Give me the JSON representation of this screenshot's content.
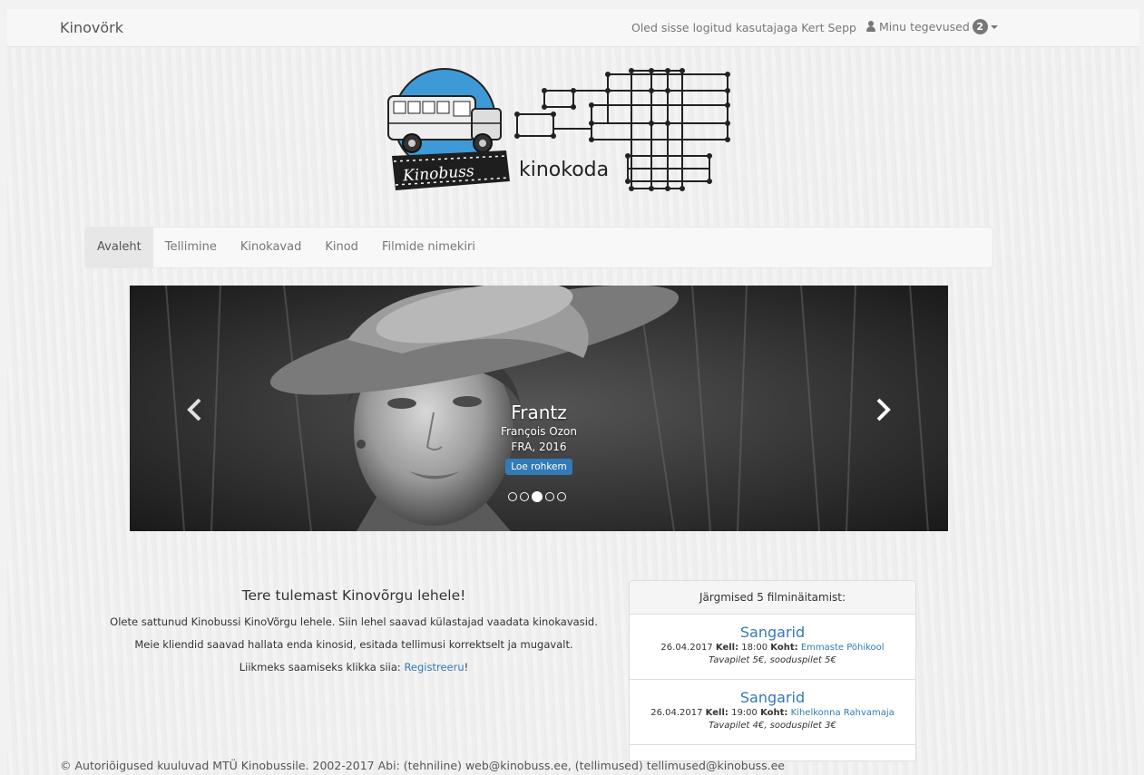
{
  "navbar": {
    "brand": "Kinovörk",
    "login_text": "Oled sisse logitud kasutajaga Kert Sepp",
    "my_actions_label": "Minu tegevused",
    "my_actions_badge": "2"
  },
  "logo": {
    "left_text": "Kinobuss",
    "right_text": "kinokoda"
  },
  "menu": {
    "items": [
      "Avaleht",
      "Tellimine",
      "Kinokavad",
      "Kinod",
      "Filmide nimekiri"
    ]
  },
  "carousel": {
    "title": "Frantz",
    "director": "François Ozon",
    "country_year": "FRA, 2016",
    "button_label": "Loe rohkem",
    "slide_count": 5,
    "active_slide": 3
  },
  "welcome": {
    "heading": "Tere tulemast Kinovõrgu lehele!",
    "line1": "Olete sattunud Kinobussi KinoVõrgu lehele. Siin lehel saavad külastajad vaadata kinokavasid.",
    "line2": "Meie kliendid saavad hallata enda kinosid, esitada tellimusi korrektselt ja mugavalt.",
    "line3_prefix": "Liikmeks saamiseks klikka siia:",
    "register_link": "Registreeru",
    "line3_suffix": "!"
  },
  "shows_panel": {
    "heading": "Järgmised 5 filminäitamist:",
    "shows": [
      {
        "title": "Sangarid",
        "date": "26.04.2017",
        "time_label": "Kell:",
        "time": "18:00",
        "place_label": "Koht:",
        "place": "Emmaste Põhikool",
        "price": "Tavapilet 5€, sooduspilet 5€"
      },
      {
        "title": "Sangarid",
        "date": "26.04.2017",
        "time_label": "Kell:",
        "time": "19:00",
        "place_label": "Koht:",
        "place": "Kihelkonna Rahvamaja",
        "price": "Tavapilet 4€, sooduspilet 3€"
      }
    ]
  },
  "footer": {
    "text": "© Autoriõigused kuuluvad MTÜ Kinobussile. 2002-2017 Abi: (tehniline) web@kinobuss.ee, (tellimused) tellimused@kinobuss.ee"
  }
}
